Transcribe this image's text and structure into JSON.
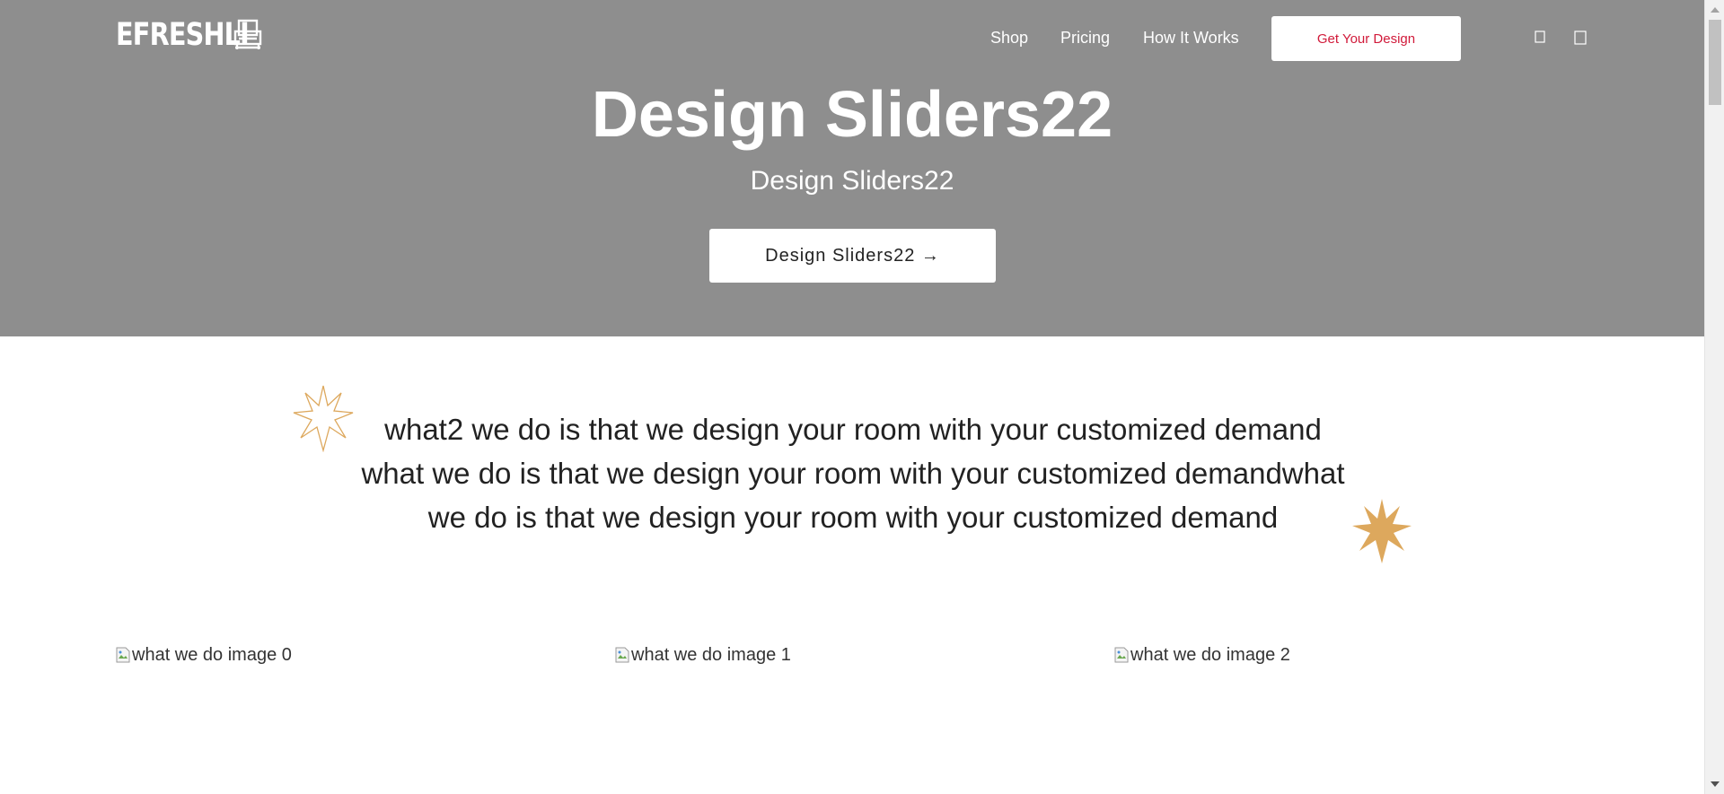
{
  "header": {
    "logo_text": "EFRESHLI",
    "nav": {
      "shop": "Shop",
      "pricing": "Pricing",
      "how_it_works": "How It Works",
      "cta": "Get Your Design"
    },
    "icons": [
      "user-icon",
      "cart-icon"
    ]
  },
  "hero": {
    "title": "Design Sliders22",
    "subtitle": "Design Sliders22",
    "button": "Design Sliders22 →",
    "background": "#8e8e8e"
  },
  "what_we_do": {
    "text": "what2 we do is that we design your room with your customized demand what we do is that we design your room with your customized demandwhat we do is that we design your room with your customized demand",
    "images": [
      {
        "alt": "what we do image 0"
      },
      {
        "alt": "what we do image 1"
      },
      {
        "alt": "what we do image 2"
      }
    ],
    "accent_color": "#dda85d"
  },
  "colors": {
    "cta_text": "#d11a3a",
    "hero_bg": "#8e8e8e"
  }
}
